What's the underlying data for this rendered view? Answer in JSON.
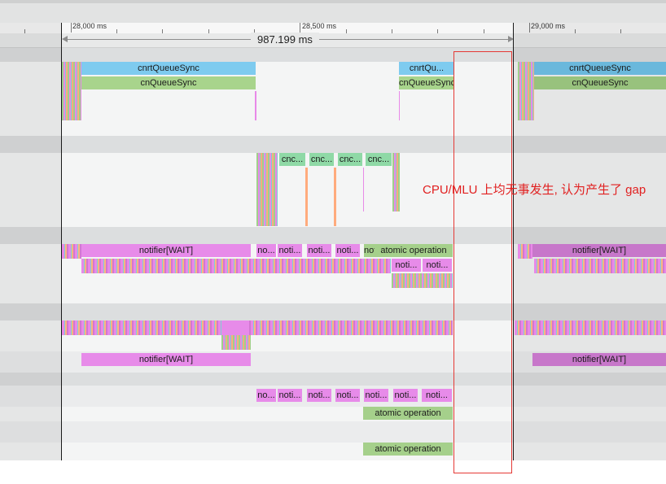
{
  "timeline": {
    "ticks": [
      {
        "label": "28,000 ms"
      },
      {
        "label": "28,500 ms"
      },
      {
        "label": "29,000 ms"
      }
    ],
    "selection_duration": "987.199 ms"
  },
  "tracks": {
    "cnrt_queue_sync": "cnrtQueueSync",
    "cnrt_queue_sync_short": "cnrtQu...",
    "cn_queue_sync": "cnQueueSync",
    "cnc_short": "cnc...",
    "notifier_wait": "notifier[WAIT]",
    "notifier_short": "noti...",
    "notifier_tiny": "no...",
    "atomic_operation": "atomic operation"
  },
  "annotation": {
    "text": "CPU/MLU 上均无事发生, 认为产生了 gap",
    "color": "#e12020"
  },
  "colors": {
    "cnrt": "#7ecbef",
    "cnqueue": "#a8d48c",
    "notifier": "#e78be9",
    "cnc": "#8fd9a6",
    "atomic": "#a5d08b"
  }
}
